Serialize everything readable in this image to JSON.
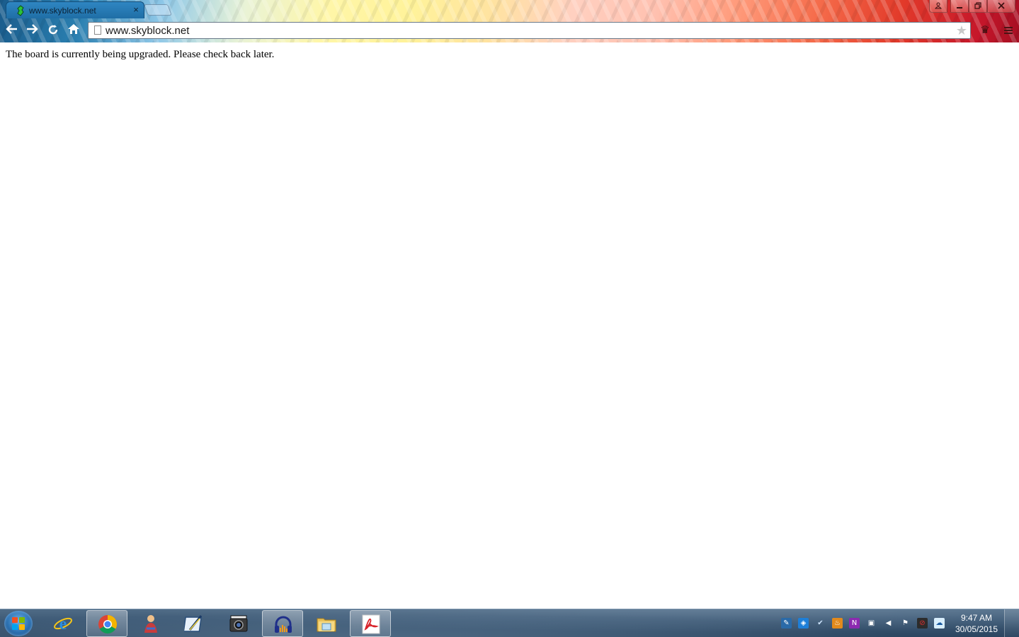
{
  "browser": {
    "tab": {
      "title": "www.skyblock.net",
      "close_label": "×"
    },
    "omnibox": {
      "url": "www.skyblock.net"
    },
    "window_buttons": {
      "minimize": "—",
      "maximize": "❐",
      "close": "✕",
      "user": "👤"
    }
  },
  "page": {
    "message": "The board is currently being upgraded. Please check back later."
  },
  "taskbar": {
    "apps": [
      {
        "name": "internet-explorer-icon",
        "active": false
      },
      {
        "name": "chrome-icon",
        "active": true
      },
      {
        "name": "people-app-icon",
        "active": false
      },
      {
        "name": "pen-editor-icon",
        "active": false
      },
      {
        "name": "video-camera-icon",
        "active": false
      },
      {
        "name": "audio-headphones-icon",
        "active": true
      },
      {
        "name": "file-explorer-icon",
        "active": false
      },
      {
        "name": "pdf-reader-icon",
        "active": true
      }
    ],
    "clock": {
      "time": "9:47 AM",
      "date": "30/05/2015"
    }
  },
  "colors": {
    "taskbar_base": "#3e5a76",
    "tab_active": "#2f86c2",
    "pdf_red": "#d8232a"
  }
}
